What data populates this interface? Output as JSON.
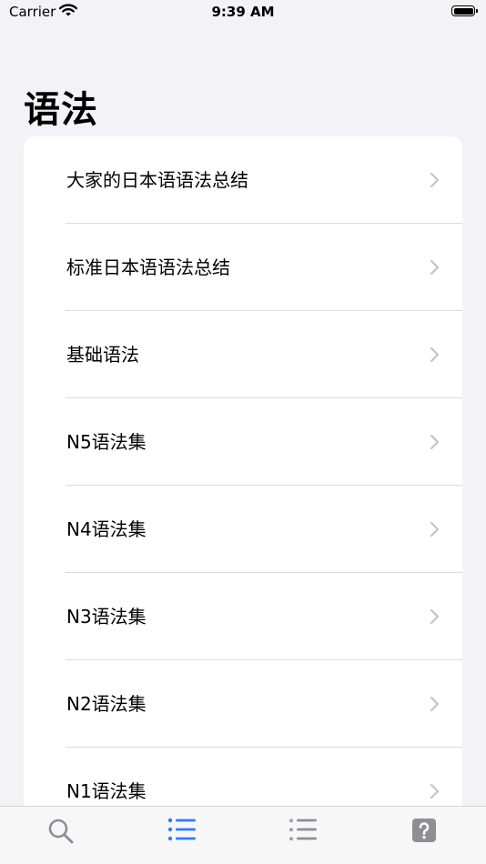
{
  "status_bar": {
    "carrier": "Carrier",
    "time": "9:39 AM"
  },
  "page_title": "语法",
  "list": {
    "items": [
      {
        "label": "大家的日本语语法总结"
      },
      {
        "label": "标准日本语语法总结"
      },
      {
        "label": "基础语法"
      },
      {
        "label": "N5语法集"
      },
      {
        "label": "N4语法集"
      },
      {
        "label": "N3语法集"
      },
      {
        "label": "N2语法集"
      },
      {
        "label": "N1语法集"
      }
    ]
  },
  "tab_bar": {
    "tabs": [
      {
        "icon": "search-icon",
        "selected": false
      },
      {
        "icon": "list-bullet-icon",
        "selected": true
      },
      {
        "icon": "star-list-icon",
        "selected": false
      },
      {
        "icon": "question-icon",
        "selected": false
      }
    ]
  },
  "colors": {
    "accent": "#2f7cf6",
    "inactive_icon": "#8e8e93",
    "background": "#f2f2f7"
  }
}
